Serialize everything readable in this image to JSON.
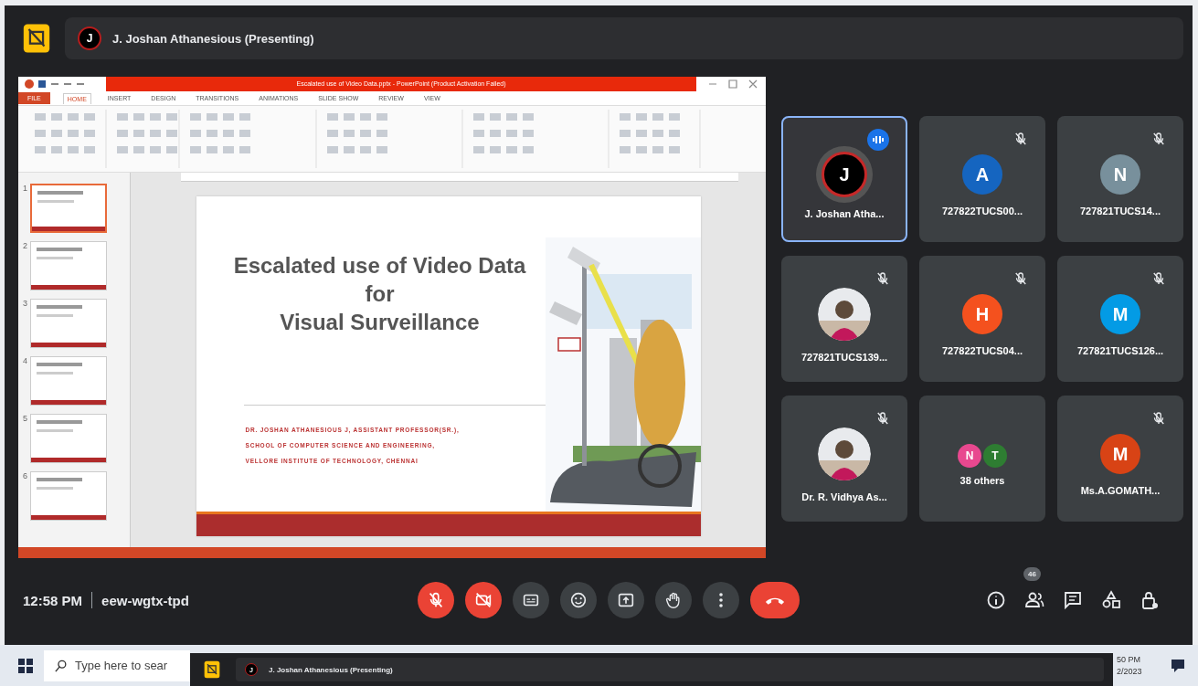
{
  "top_bar": {
    "presenter": "J. Joshan Athanesious (Presenting)",
    "avatar_letter": "J"
  },
  "shared_screen": {
    "app_title": "Escalated use of Video Data.pptx - PowerPoint (Product Activation Failed)",
    "ribbon_tabs": [
      {
        "label": "FILE",
        "kind": "file",
        "selected": false
      },
      {
        "label": "HOME",
        "kind": "tab",
        "selected": true
      },
      {
        "label": "INSERT",
        "kind": "tab",
        "selected": false
      },
      {
        "label": "DESIGN",
        "kind": "tab",
        "selected": false
      },
      {
        "label": "TRANSITIONS",
        "kind": "tab",
        "selected": false
      },
      {
        "label": "ANIMATIONS",
        "kind": "tab",
        "selected": false
      },
      {
        "label": "SLIDE SHOW",
        "kind": "tab",
        "selected": false
      },
      {
        "label": "REVIEW",
        "kind": "tab",
        "selected": false
      },
      {
        "label": "VIEW",
        "kind": "tab",
        "selected": false
      }
    ],
    "slide_thumbnails": [
      {
        "number": "1",
        "selected": true
      },
      {
        "number": "2",
        "selected": false
      },
      {
        "number": "3",
        "selected": false
      },
      {
        "number": "4",
        "selected": false
      },
      {
        "number": "5",
        "selected": false
      },
      {
        "number": "6",
        "selected": false
      }
    ],
    "slide": {
      "title_lines": [
        "Escalated use of Video Data",
        "for",
        "Visual Surveillance"
      ],
      "author_lines": [
        "DR. JOSHAN ATHANESIOUS J, ASSISTANT PROFESSOR(SR.),",
        "SCHOOL OF COMPUTER SCIENCE AND ENGINEERING,",
        "VELLORE INSTITUTE OF TECHNOLOGY, CHENNAI"
      ]
    }
  },
  "tiles": [
    {
      "name": "J. Joshan Atha...",
      "kind": "letter",
      "avatar": "J",
      "color": "#000000",
      "speaking": true,
      "muted": false
    },
    {
      "name": "727822TUCS00...",
      "kind": "letter",
      "avatar": "A",
      "color": "#1565c0",
      "speaking": false,
      "muted": true
    },
    {
      "name": "727821TUCS14...",
      "kind": "letter",
      "avatar": "N",
      "color": "#78909c",
      "speaking": false,
      "muted": true
    },
    {
      "name": "727821TUCS139...",
      "kind": "picture",
      "speaking": false,
      "muted": true
    },
    {
      "name": "727822TUCS04...",
      "kind": "letter",
      "avatar": "H",
      "color": "#f4511e",
      "speaking": false,
      "muted": true
    },
    {
      "name": "727821TUCS126...",
      "kind": "letter",
      "avatar": "M",
      "color": "#039be5",
      "speaking": false,
      "muted": true
    },
    {
      "name": "Dr. R. Vidhya As...",
      "kind": "picture",
      "speaking": false,
      "muted": true
    },
    {
      "name": "38 others",
      "kind": "others",
      "others": [
        {
          "avatar": "N",
          "color": "#e8488f"
        },
        {
          "avatar": "T",
          "color": "#2e7d32"
        }
      ],
      "speaking": false,
      "muted": false
    },
    {
      "name": "Ms.A.GOMATH...",
      "kind": "letter",
      "avatar": "M",
      "color": "#d84315",
      "speaking": false,
      "muted": true
    }
  ],
  "bottom_bar": {
    "time": "12:58 PM",
    "meeting_code": "eew-wgtx-tpd",
    "controls": [
      {
        "kind": "mic",
        "off": true
      },
      {
        "kind": "camera",
        "off": true
      },
      {
        "kind": "captions",
        "off": false
      },
      {
        "kind": "emoji",
        "off": false
      },
      {
        "kind": "present",
        "off": false
      },
      {
        "kind": "hand",
        "off": false
      },
      {
        "kind": "more",
        "off": false
      },
      {
        "kind": "end"
      }
    ],
    "side_controls": [
      {
        "kind": "info"
      },
      {
        "kind": "people",
        "badge": "46"
      },
      {
        "kind": "chat"
      },
      {
        "kind": "activities"
      },
      {
        "kind": "lock"
      }
    ]
  },
  "taskbar": {
    "search_placeholder": "Type here to sear",
    "window_title": "J. Joshan Athanesious (Presenting)",
    "window_avatar": "J",
    "time": "50 PM",
    "date": "2/2023"
  }
}
